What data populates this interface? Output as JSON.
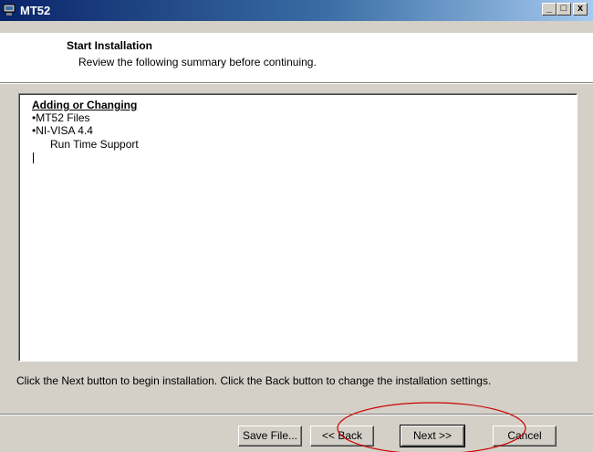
{
  "window": {
    "title": "MT52"
  },
  "title_buttons": {
    "minimize": "_",
    "maximize": "□",
    "close": "x"
  },
  "header": {
    "title": "Start Installation",
    "subtitle": "Review the following summary before continuing."
  },
  "summary": {
    "heading": "Adding or Changing",
    "items": [
      "•MT52 Files",
      "•NI-VISA 4.4"
    ],
    "subitem": "Run Time Support"
  },
  "info_text": "Click the Next button to begin installation.  Click the Back button to change the installation settings.",
  "buttons": {
    "save": "Save File...",
    "back": "<< Back",
    "next": "Next >>",
    "cancel": "Cancel"
  },
  "colors": {
    "titlebar": "#0a246a",
    "annotation": "#cc0000"
  }
}
